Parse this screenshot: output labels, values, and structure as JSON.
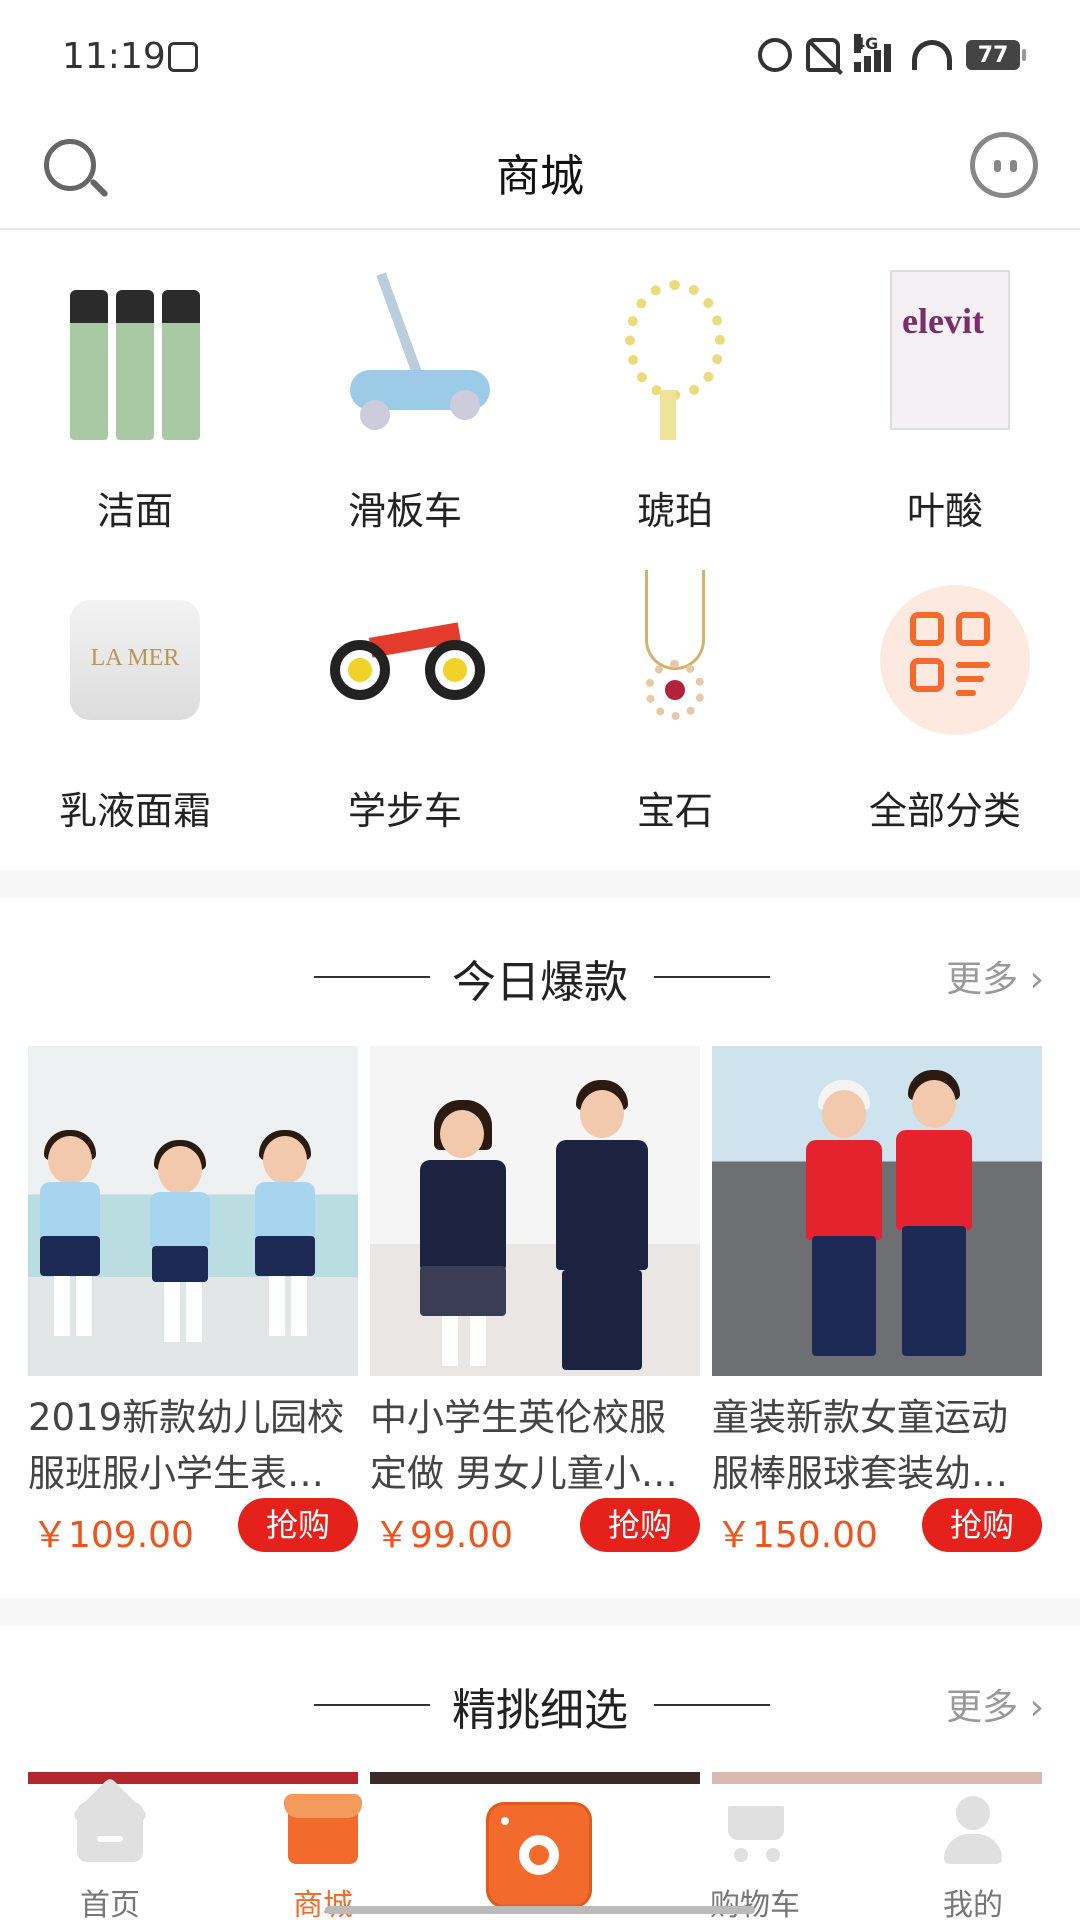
{
  "status_bar": {
    "time": "11:19",
    "network": "4G",
    "battery": "77"
  },
  "header": {
    "title": "商城"
  },
  "categories": [
    {
      "label": "洁面",
      "icon": "cleanser-bottles"
    },
    {
      "label": "滑板车",
      "icon": "scooter"
    },
    {
      "label": "琥珀",
      "icon": "amber-beads"
    },
    {
      "label": "叶酸",
      "icon": "elevit-box"
    },
    {
      "label": "乳液面霜",
      "icon": "cream-jar"
    },
    {
      "label": "学步车",
      "icon": "balance-bike"
    },
    {
      "label": "宝石",
      "icon": "gem-necklace"
    },
    {
      "label": "全部分类",
      "icon": "all-categories-icon"
    }
  ],
  "category_images": {
    "elevit_text": "elevit",
    "jar_text": "LA MER"
  },
  "section_hot": {
    "title": "今日爆款",
    "more": "更多",
    "products": [
      {
        "name": "2019新款幼儿园校服班服小学生表…",
        "price": "￥109.00",
        "buy": "抢购"
      },
      {
        "name": "中小学生英伦校服定做 男女儿童小…",
        "price": "￥99.00",
        "buy": "抢购"
      },
      {
        "name": "童装新款女童运动服棒服球套装幼…",
        "price": "￥150.00",
        "buy": "抢购"
      }
    ]
  },
  "section_picks": {
    "title": "精挑细选",
    "more": "更多"
  },
  "bottom_nav": {
    "items": [
      {
        "label": "首页",
        "active": false
      },
      {
        "label": "商城",
        "active": true
      },
      {
        "label": "购物车",
        "active": false
      },
      {
        "label": "我的",
        "active": false
      }
    ]
  },
  "colors": {
    "accent": "#f26b2c",
    "price": "#f0531c",
    "buy_button": "#e5211c"
  }
}
